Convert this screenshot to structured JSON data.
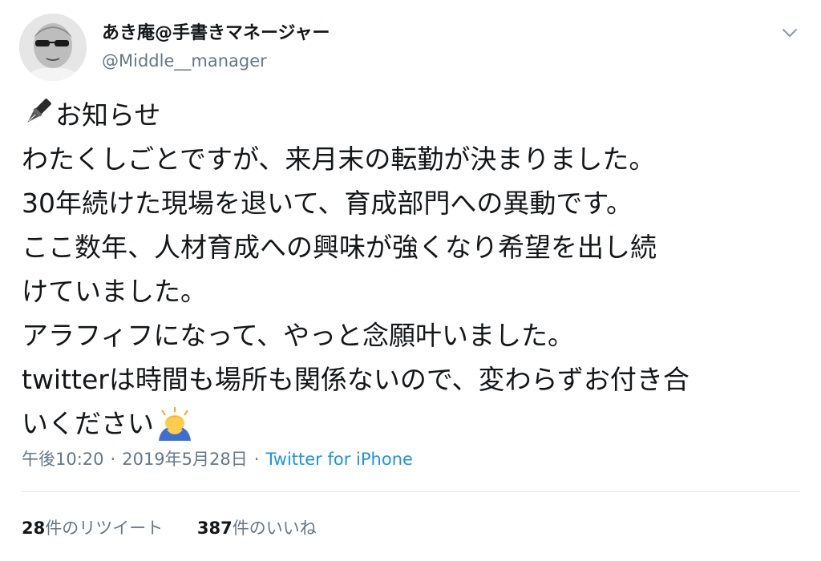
{
  "colors": {
    "text": "#14171a",
    "muted": "#657786",
    "link": "#1b95e0",
    "divider": "#e1e8ed"
  },
  "user": {
    "display_name": "あき庵@手書きマネージャー",
    "handle": "@Middle__manager",
    "avatar_icon": "avatar",
    "menu_icon": "chevron-down-icon"
  },
  "tweet": {
    "lines": [
      "お知らせ",
      "わたくしごとですが、来月末の転勤が決まりました。",
      "30年続けた現場を退いて、育成部門への異動です。",
      "ここ数年、人材育成への興味が強くなり希望を出し続",
      "けていました。",
      "アラフィフになって、やっと念願叶いました。",
      "twitterは時間も場所も関係ないので、変わらずお付き合",
      "いください"
    ],
    "leading_emoji": "fountain-pen-icon",
    "trailing_emoji": "person-bowing-icon"
  },
  "meta": {
    "time": "午後10:20",
    "separator": "·",
    "date": "2019年5月28日",
    "source": "Twitter for iPhone"
  },
  "stats": {
    "retweets_count": "28",
    "retweets_label": "件のリツイート",
    "likes_count": "387",
    "likes_label": "件のいいね"
  }
}
